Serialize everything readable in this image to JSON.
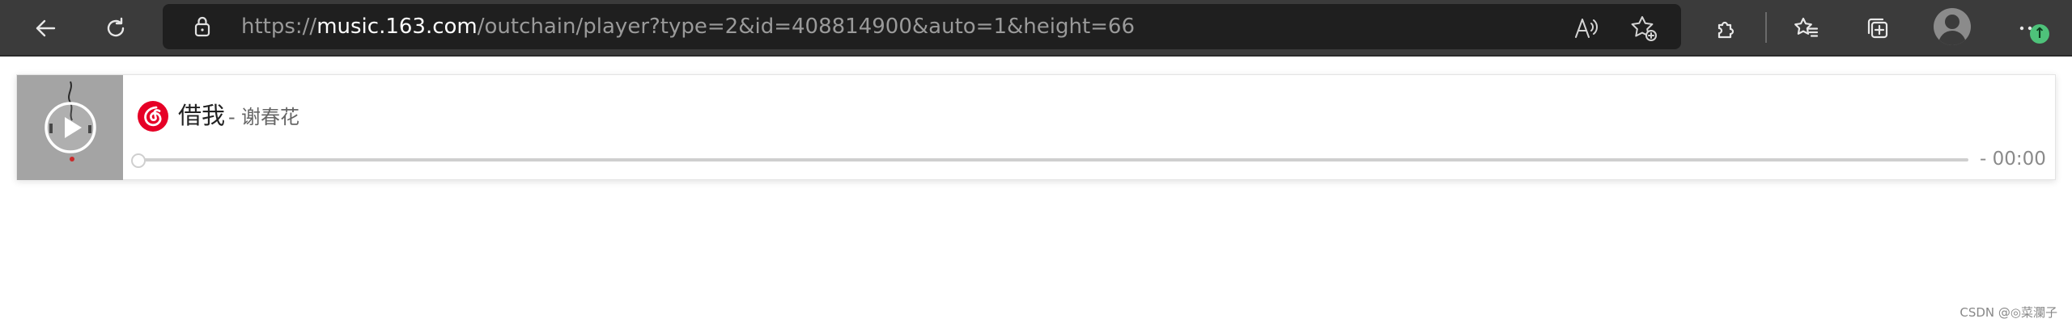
{
  "browser": {
    "url_prefix": "https://",
    "url_host": "music.163.com",
    "url_path": "/outchain/player?type=2&id=408814900&auto=1&height=66",
    "icons": [
      "back-icon",
      "refresh-icon",
      "lock-icon",
      "read-aloud-icon",
      "add-favorite-icon",
      "extensions-icon",
      "favorites-icon",
      "collections-icon",
      "profile-icon",
      "more-icon"
    ]
  },
  "player": {
    "song_title": "借我",
    "separator": "-",
    "artist": "谢春花",
    "time": "- 00:00",
    "progress": 0
  },
  "colors": {
    "toolbar_bg": "#3b3b3b",
    "address_bg": "#1f1f1f",
    "netease_red": "#e60026",
    "progress_track": "#cfcfcf"
  },
  "watermark": "CSDN @◎菜瀾子"
}
